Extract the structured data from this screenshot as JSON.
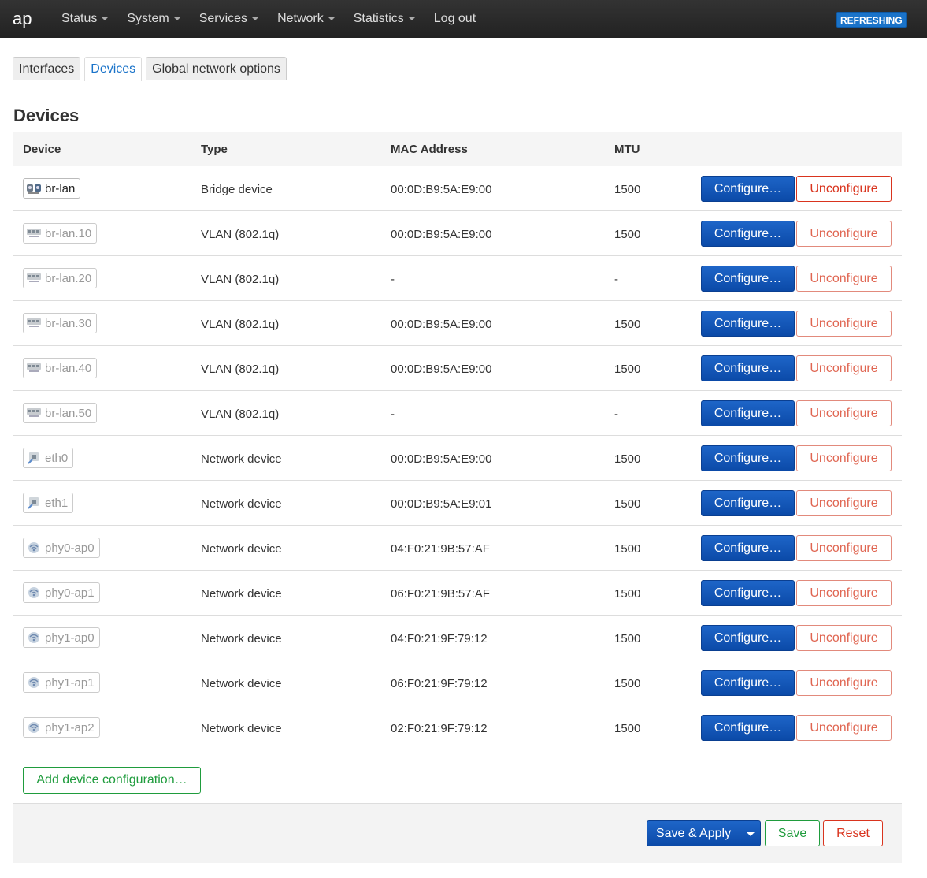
{
  "navbar": {
    "brand": "ap",
    "menu": [
      "Status",
      "System",
      "Services",
      "Network",
      "Statistics",
      "Log out"
    ],
    "refresh_badge": "REFRESHING"
  },
  "tabs": [
    "Interfaces",
    "Devices",
    "Global network options"
  ],
  "active_tab": "Devices",
  "section_title": "Devices",
  "table": {
    "headers": {
      "device": "Device",
      "type": "Type",
      "mac": "MAC Address",
      "mtu": "MTU"
    },
    "rows": [
      {
        "device": "br-lan",
        "icon": "bridge-icon",
        "active": true,
        "type": "Bridge device",
        "mac": "00:0D:B9:5A:E9:00",
        "mtu": "1500"
      },
      {
        "device": "br-lan.10",
        "icon": "vlan-icon",
        "active": false,
        "type": "VLAN (802.1q)",
        "mac": "00:0D:B9:5A:E9:00",
        "mtu": "1500"
      },
      {
        "device": "br-lan.20",
        "icon": "vlan-icon",
        "active": false,
        "type": "VLAN (802.1q)",
        "mac": "-",
        "mtu": "-"
      },
      {
        "device": "br-lan.30",
        "icon": "vlan-icon",
        "active": false,
        "type": "VLAN (802.1q)",
        "mac": "00:0D:B9:5A:E9:00",
        "mtu": "1500"
      },
      {
        "device": "br-lan.40",
        "icon": "vlan-icon",
        "active": false,
        "type": "VLAN (802.1q)",
        "mac": "00:0D:B9:5A:E9:00",
        "mtu": "1500"
      },
      {
        "device": "br-lan.50",
        "icon": "vlan-icon",
        "active": false,
        "type": "VLAN (802.1q)",
        "mac": "-",
        "mtu": "-"
      },
      {
        "device": "eth0",
        "icon": "ethernet-icon",
        "active": false,
        "type": "Network device",
        "mac": "00:0D:B9:5A:E9:00",
        "mtu": "1500"
      },
      {
        "device": "eth1",
        "icon": "ethernet-icon",
        "active": false,
        "type": "Network device",
        "mac": "00:0D:B9:5A:E9:01",
        "mtu": "1500"
      },
      {
        "device": "phy0-ap0",
        "icon": "wifi-icon",
        "active": false,
        "type": "Network device",
        "mac": "04:F0:21:9B:57:AF",
        "mtu": "1500"
      },
      {
        "device": "phy0-ap1",
        "icon": "wifi-icon",
        "active": false,
        "type": "Network device",
        "mac": "06:F0:21:9B:57:AF",
        "mtu": "1500"
      },
      {
        "device": "phy1-ap0",
        "icon": "wifi-icon",
        "active": false,
        "type": "Network device",
        "mac": "04:F0:21:9F:79:12",
        "mtu": "1500"
      },
      {
        "device": "phy1-ap1",
        "icon": "wifi-icon",
        "active": false,
        "type": "Network device",
        "mac": "06:F0:21:9F:79:12",
        "mtu": "1500"
      },
      {
        "device": "phy1-ap2",
        "icon": "wifi-icon",
        "active": false,
        "type": "Network device",
        "mac": "02:F0:21:9F:79:12",
        "mtu": "1500"
      }
    ],
    "configure_label": "Configure…",
    "unconfigure_label": "Unconfigure"
  },
  "add_button": "Add device configuration…",
  "actions": {
    "save_apply": "Save & Apply",
    "save": "Save",
    "reset": "Reset"
  },
  "colors": {
    "primary": "#0f52ba",
    "positive": "#1f9c3d",
    "negative": "#d9341e",
    "badge": "#1a73c9"
  }
}
